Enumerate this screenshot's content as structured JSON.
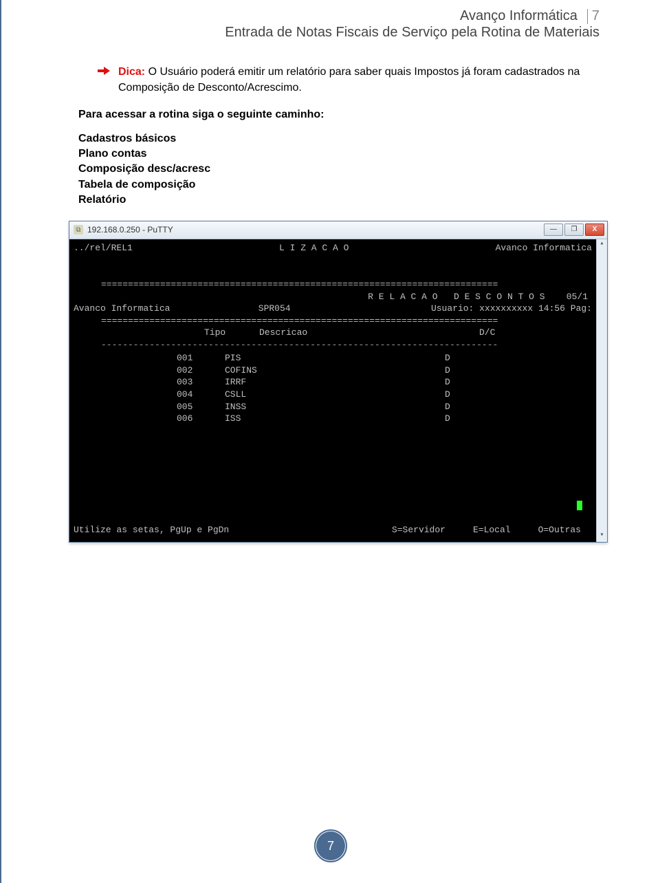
{
  "header": {
    "company": "Avanço Informática",
    "page_no": "7",
    "subtitle": "Entrada de Notas Fiscais de Serviço pela Rotina de Materiais"
  },
  "tip": {
    "label": "Dica:",
    "text": " O Usuário poderá emitir um relatório para saber quais Impostos já foram cadastrados na Composição de Desconto/Acrescimo."
  },
  "path_intro": "Para acessar a rotina siga o seguinte caminho:",
  "path_items": [
    "Cadastros básicos",
    "Plano contas",
    "Composição desc/acresc",
    "Tabela de composição",
    "Relatório"
  ],
  "window": {
    "title": "192.168.0.250 - PuTTY",
    "min_label": "—",
    "max_label": "❐",
    "close_label": "X"
  },
  "terminal": {
    "top_left": "../rel/REL1",
    "top_center": "L I Z A C A O",
    "top_right": "Avanco Informatica",
    "sep_double": "==========================================================================",
    "sep_dash": "--------------------------------------------------------------------------",
    "report_title_right": "R E L A C A O   D E S C O N T O S    05/1",
    "report_left": "Avanco Informatica",
    "report_center": "SPR054",
    "report_right": "Usuario: xxxxxxxxxx 14:56 Pag:",
    "col_tipo": "Tipo",
    "col_desc": "Descricao",
    "col_dc": "D/C",
    "rows": [
      {
        "tipo": "001",
        "desc": "PIS",
        "dc": "D"
      },
      {
        "tipo": "002",
        "desc": "COFINS",
        "dc": "D"
      },
      {
        "tipo": "003",
        "desc": "IRRF",
        "dc": "D"
      },
      {
        "tipo": "004",
        "desc": "CSLL",
        "dc": "D"
      },
      {
        "tipo": "005",
        "desc": "INSS",
        "dc": "D"
      },
      {
        "tipo": "006",
        "desc": "ISS",
        "dc": "D"
      }
    ],
    "footer_left": "Utilize as setas, PgUp e PgDn",
    "footer_s": "S=Servidor",
    "footer_e": "E=Local",
    "footer_o": "O=Outras"
  },
  "footer_page": "7"
}
